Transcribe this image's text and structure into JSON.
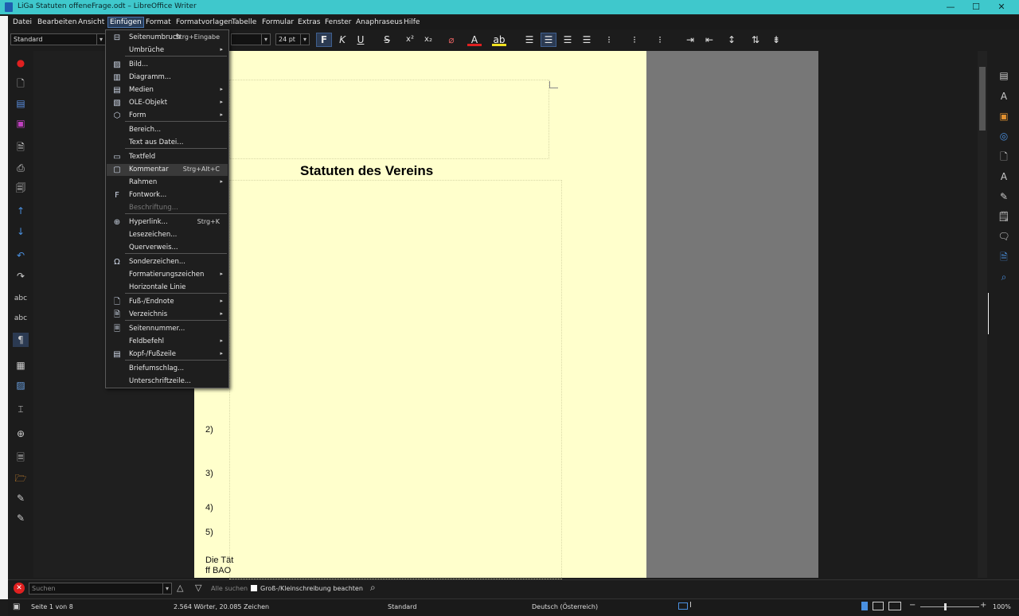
{
  "window": {
    "title": "LiGa Statuten offeneFrage.odt – LibreOffice Writer"
  },
  "menubar": [
    "Datei",
    "Bearbeiten",
    "Ansicht",
    "Einfügen",
    "Format",
    "Formatvorlagen",
    "Tabelle",
    "Formular",
    "Extras",
    "Fenster",
    "Anaphraseus",
    "Hilfe"
  ],
  "toolbar": {
    "style": "Standard",
    "font_size": "24 pt",
    "bold": "F",
    "italic": "K",
    "underline": "U",
    "strike": "S"
  },
  "insert_menu": {
    "items": [
      {
        "label": "Seitenumbruch",
        "shortcut": "Strg+Eingabe",
        "sub": false,
        "icon": "page-break-icon"
      },
      {
        "label": "Umbrüche",
        "shortcut": "",
        "sub": true,
        "icon": ""
      },
      {
        "label": "Bild...",
        "shortcut": "",
        "sub": false,
        "icon": "image-icon"
      },
      {
        "label": "Diagramm...",
        "shortcut": "",
        "sub": false,
        "icon": "chart-icon"
      },
      {
        "label": "Medien",
        "shortcut": "",
        "sub": true,
        "icon": "media-icon"
      },
      {
        "label": "OLE-Objekt",
        "shortcut": "",
        "sub": true,
        "icon": "ole-object-icon"
      },
      {
        "label": "Form",
        "shortcut": "",
        "sub": true,
        "icon": "shapes-icon"
      },
      {
        "label": "Bereich...",
        "shortcut": "",
        "sub": false,
        "icon": ""
      },
      {
        "label": "Text aus Datei...",
        "shortcut": "",
        "sub": false,
        "icon": ""
      },
      {
        "label": "Textfeld",
        "shortcut": "",
        "sub": false,
        "icon": "textbox-icon"
      },
      {
        "label": "Kommentar",
        "shortcut": "Strg+Alt+C",
        "sub": false,
        "icon": "comment-icon"
      },
      {
        "label": "Rahmen",
        "shortcut": "",
        "sub": true,
        "icon": ""
      },
      {
        "label": "Fontwork...",
        "shortcut": "",
        "sub": false,
        "icon": "fontwork-icon"
      },
      {
        "label": "Beschriftung...",
        "shortcut": "",
        "sub": false,
        "icon": ""
      },
      {
        "label": "Hyperlink...",
        "shortcut": "Strg+K",
        "sub": false,
        "icon": "hyperlink-icon"
      },
      {
        "label": "Lesezeichen...",
        "shortcut": "",
        "sub": false,
        "icon": ""
      },
      {
        "label": "Querverweis...",
        "shortcut": "",
        "sub": false,
        "icon": ""
      },
      {
        "label": "Sonderzeichen...",
        "shortcut": "",
        "sub": false,
        "icon": "omega-icon"
      },
      {
        "label": "Formatierungszeichen",
        "shortcut": "",
        "sub": true,
        "icon": ""
      },
      {
        "label": "Horizontale Linie",
        "shortcut": "",
        "sub": false,
        "icon": ""
      },
      {
        "label": "Fuß-/Endnote",
        "shortcut": "",
        "sub": true,
        "icon": "footnote-icon"
      },
      {
        "label": "Verzeichnis",
        "shortcut": "",
        "sub": true,
        "icon": "index-icon"
      },
      {
        "label": "Seitennummer...",
        "shortcut": "",
        "sub": false,
        "icon": "page-number-icon"
      },
      {
        "label": "Feldbefehl",
        "shortcut": "",
        "sub": true,
        "icon": ""
      },
      {
        "label": "Kopf-/Fußzeile",
        "shortcut": "",
        "sub": true,
        "icon": "header-footer-icon"
      },
      {
        "label": "Briefumschlag...",
        "shortcut": "",
        "sub": false,
        "icon": ""
      },
      {
        "label": "Unterschriftzeile...",
        "shortcut": "",
        "sub": false,
        "icon": ""
      }
    ]
  },
  "document": {
    "title": "Statuten des Vereins",
    "lines": [
      "2)",
      "3)",
      "4)",
      "5)",
      "Die Tät",
      "ff BAO"
    ]
  },
  "findbar": {
    "placeholder": "Suchen",
    "find_all": "Alle suchen",
    "match_case": "Groß-/Kleinschreibung beachten"
  },
  "statusbar": {
    "page": "Seite 1 von 8",
    "words": "2.564 Wörter, 20.085 Zeichen",
    "style": "Standard",
    "language": "Deutsch (Österreich)",
    "zoom": "100%"
  }
}
